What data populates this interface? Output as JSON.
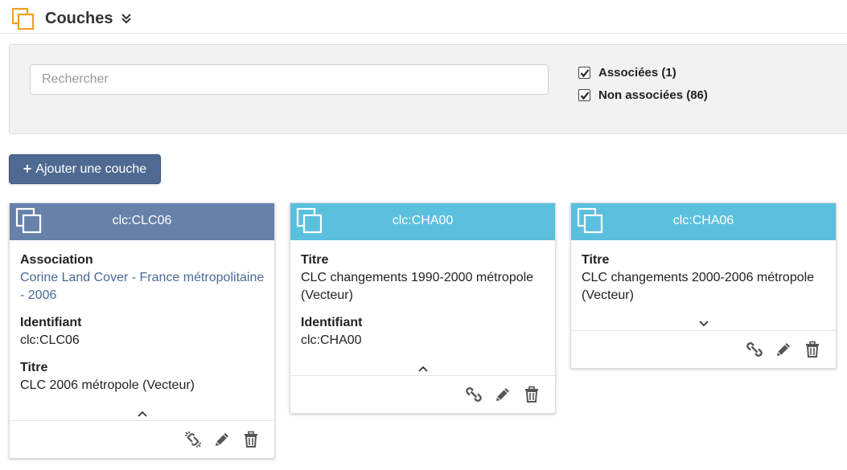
{
  "header": {
    "title": "Couches",
    "icon": "layers-icon",
    "accent": "#f0a020"
  },
  "filters": {
    "search_placeholder": "Rechercher",
    "search_value": "",
    "associated_label": "Associées (1)",
    "associated_checked": true,
    "non_associated_label": "Non associées (86)",
    "non_associated_checked": true
  },
  "toolbar": {
    "add_label": "Ajouter une couche",
    "add_color": "#4f6a92"
  },
  "colors": {
    "associated_header": "#6682a9",
    "non_associated_header": "#5bc0de",
    "link": "#4a6a97"
  },
  "cards": [
    {
      "name": "clc:CLC06",
      "associated": true,
      "fields": [
        {
          "label": "Association",
          "value": "Corine Land Cover - France métropolitaine - 2006",
          "is_link": true
        },
        {
          "label": "Identifiant",
          "value": "clc:CLC06"
        },
        {
          "label": "Titre",
          "value": "CLC 2006 métropole (Vecteur)"
        }
      ],
      "expanded": true,
      "actions": [
        "unlink-icon",
        "pencil-icon",
        "trash-icon"
      ]
    },
    {
      "name": "clc:CHA00",
      "associated": false,
      "fields": [
        {
          "label": "Titre",
          "value": "CLC changements 1990-2000 métropole (Vecteur)"
        },
        {
          "label": "Identifiant",
          "value": "clc:CHA00"
        }
      ],
      "expanded": true,
      "actions": [
        "link-icon",
        "pencil-icon",
        "trash-icon"
      ]
    },
    {
      "name": "clc:CHA06",
      "associated": false,
      "fields": [
        {
          "label": "Titre",
          "value": "CLC changements 2000-2006 métropole (Vecteur)"
        }
      ],
      "expanded": false,
      "actions": [
        "link-icon",
        "pencil-icon",
        "trash-icon"
      ]
    }
  ]
}
